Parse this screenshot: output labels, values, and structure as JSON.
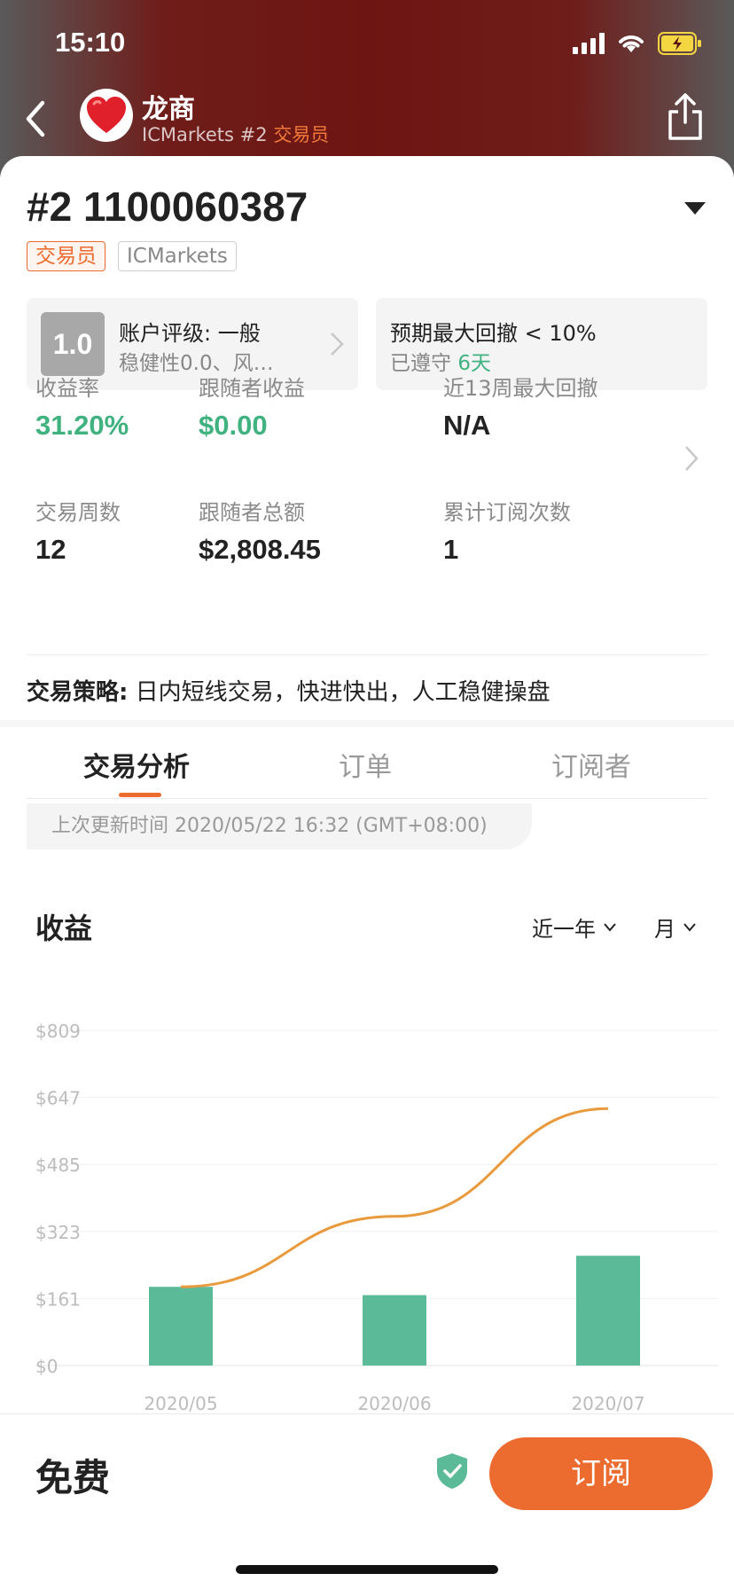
{
  "status": {
    "time": "15:10"
  },
  "header": {
    "name": "龙商",
    "broker": "ICMarkets #2",
    "role": "交易员"
  },
  "account": {
    "title": "#2 1100060387",
    "tags": {
      "role": "交易员",
      "broker": "ICMarkets"
    }
  },
  "rating": {
    "score": "1.0",
    "title": "账户评级: 一般",
    "desc": "稳健性0.0、风…"
  },
  "drawdown": {
    "title": "预期最大回撤 < 10%",
    "prefix": "已遵守",
    "days": "6天"
  },
  "stats": [
    {
      "label": "收益率",
      "value": "31.20%"
    },
    {
      "label": "跟随者收益",
      "value": "$0.00"
    },
    {
      "label": "近13周最大回撤",
      "value": "N/A"
    },
    {
      "label": "交易周数",
      "value": "12"
    },
    {
      "label": "跟随者总额",
      "value": "$2,808.45"
    },
    {
      "label": "累计订阅次数",
      "value": "1"
    }
  ],
  "strategy": {
    "label": "交易策略:",
    "text": "日内短线交易，快进快出，人工稳健操盘"
  },
  "tabs": [
    "交易分析",
    "订单",
    "订阅者"
  ],
  "last_updated": "上次更新时间 2020/05/22 16:32 (GMT+08:00)",
  "chart_section": {
    "title": "收益",
    "range": "近一年",
    "period": "月"
  },
  "chart_data": {
    "type": "bar",
    "categories": [
      "2020/05",
      "2020/06",
      "2020/07"
    ],
    "series": [
      {
        "type": "bar",
        "values": [
          190,
          170,
          265
        ]
      },
      {
        "type": "line",
        "values": [
          190,
          360,
          620
        ]
      }
    ],
    "yticks": [
      "$0",
      "$161",
      "$323",
      "$485",
      "$647",
      "$809"
    ],
    "ylim": [
      0,
      809
    ],
    "grid": true,
    "colors": {
      "bar": "#5bbb98",
      "line": "#e99a3c"
    }
  },
  "bottom": {
    "price": "免费",
    "subscribe": "订阅"
  },
  "colors": {
    "accent": "#ec6b2f",
    "positive": "#3fb27f"
  },
  "icons": [
    "back-arrow-icon",
    "heart-icon",
    "share-icon",
    "chevron-down-icon",
    "chevron-right-icon",
    "shield-check-icon"
  ]
}
